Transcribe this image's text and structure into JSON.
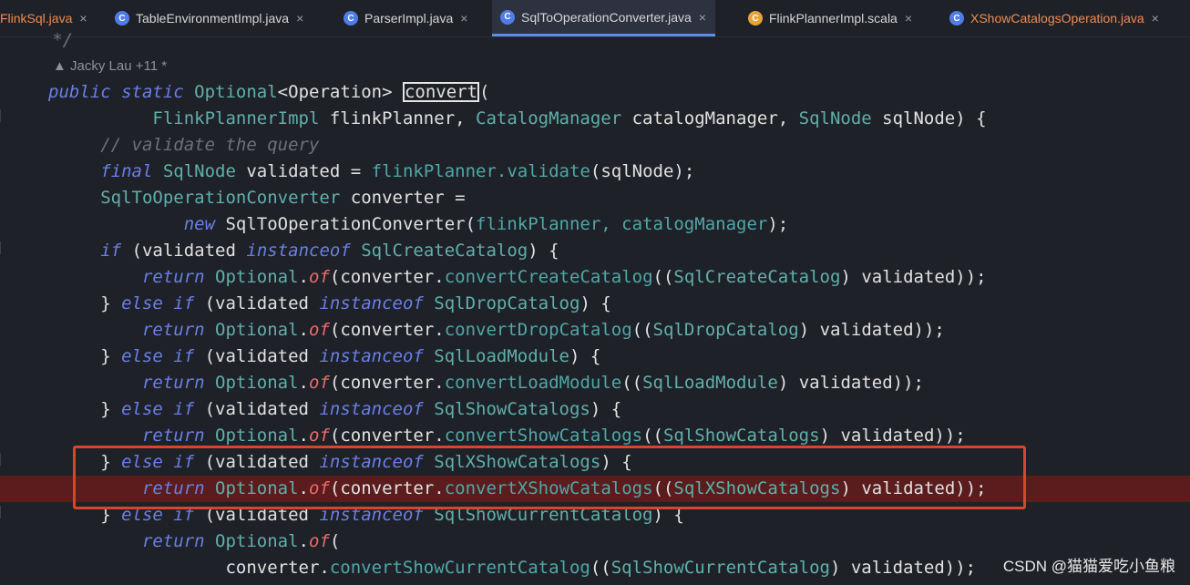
{
  "tabs": [
    {
      "label": "FlinkSql.java",
      "icon": "none",
      "active": false
    },
    {
      "label": "TableEnvironmentImpl.java",
      "icon": "class-icon",
      "active": false
    },
    {
      "label": "ParserImpl.java",
      "icon": "class-icon",
      "active": false
    },
    {
      "label": "SqlToOperationConverter.java",
      "icon": "class-icon",
      "active": true
    },
    {
      "label": "FlinkPlannerImpl.scala",
      "icon": "scala-class-icon",
      "active": false
    },
    {
      "label": "XShowCatalogsOperation.java",
      "icon": "class-icon",
      "active": false
    }
  ],
  "tab_close_glyph": "×",
  "tab_icon_letter": "C",
  "author_annotation": "Jacky Lau +11 *",
  "code": {
    "l0": "     */",
    "l2a": "public static ",
    "l2b": "Optional",
    "l2c": "<",
    "l2d": "Operation",
    "l2e": "> ",
    "l2f": "convert",
    "l2g": "(",
    "l3a": "          ",
    "l3b": "FlinkPlannerImpl",
    "l3c": " flinkPlanner, ",
    "l3d": "CatalogManager",
    "l3e": " catalogManager, ",
    "l3f": "SqlNode",
    "l3g": " sqlNode) {",
    "l4": "     // validate the query",
    "l5a": "     ",
    "l5b": "final ",
    "l5c": "SqlNode",
    "l5d": " validated = ",
    "l5e": "flinkPlanner.",
    "l5f": "validate",
    "l5g": "(sqlNode);",
    "l6a": "     ",
    "l6b": "SqlToOperationConverter",
    "l6c": " converter =",
    "l7a": "             ",
    "l7b": "new ",
    "l7c": "SqlToOperationConverter(",
    "l7d": "flinkPlanner, catalogManager",
    "l7e": ");",
    "l8a": "     ",
    "l8b": "if",
    "l8c": " (validated ",
    "l8d": "instanceof ",
    "l8e": "SqlCreateCatalog",
    "l8f": ") {",
    "l9a": "         ",
    "l9b": "return ",
    "l9c": "Optional",
    "l9d": ".",
    "l9e": "of",
    "l9f": "(converter.",
    "l9g": "convertCreateCatalog",
    "l9h": "((",
    "l9i": "SqlCreateCatalog",
    "l9j": ") validated));",
    "l10a": "     } ",
    "l10b": "else if",
    "l10c": " (validated ",
    "l10d": "instanceof ",
    "l10e": "SqlDropCatalog",
    "l10f": ") {",
    "l11a": "         ",
    "l11b": "return ",
    "l11c": "Optional",
    "l11d": ".",
    "l11e": "of",
    "l11f": "(converter.",
    "l11g": "convertDropCatalog",
    "l11h": "((",
    "l11i": "SqlDropCatalog",
    "l11j": ") validated));",
    "l12a": "     } ",
    "l12b": "else if",
    "l12c": " (validated ",
    "l12d": "instanceof ",
    "l12e": "SqlLoadModule",
    "l12f": ") {",
    "l13a": "         ",
    "l13b": "return ",
    "l13c": "Optional",
    "l13d": ".",
    "l13e": "of",
    "l13f": "(converter.",
    "l13g": "convertLoadModule",
    "l13h": "((",
    "l13i": "SqlLoadModule",
    "l13j": ") validated));",
    "l14a": "     } ",
    "l14b": "else if",
    "l14c": " (validated ",
    "l14d": "instanceof ",
    "l14e": "SqlShowCatalogs",
    "l14f": ") {",
    "l15a": "         ",
    "l15b": "return ",
    "l15c": "Optional",
    "l15d": ".",
    "l15e": "of",
    "l15f": "(converter.",
    "l15g": "convertShowCatalogs",
    "l15h": "((",
    "l15i": "SqlShowCatalogs",
    "l15j": ") validated));",
    "l16a": "     } ",
    "l16b": "else if",
    "l16c": " (validated ",
    "l16d": "instanceof ",
    "l16e": "SqlXShowCatalogs",
    "l16f": ") {",
    "l17a": "         ",
    "l17b": "return ",
    "l17c": "Optional",
    "l17d": ".",
    "l17e": "of",
    "l17f": "(converter.",
    "l17g": "convertXShowCatalogs",
    "l17h": "((",
    "l17i": "SqlXShowCatalogs",
    "l17j": ") validated));",
    "l18a": "     } ",
    "l18b": "else if",
    "l18c": " (validated ",
    "l18d": "instanceof ",
    "l18e": "SqlShowCurrentCatalog",
    "l18f": ") {",
    "l19a": "         ",
    "l19b": "return ",
    "l19c": "Optional",
    "l19d": ".",
    "l19e": "of",
    "l19f": "(",
    "l20a": "                 converter.",
    "l20b": "convertShowCurrentCatalog",
    "l20c": "((",
    "l20d": "SqlShowCurrentCatalog",
    "l20e": ") validated));"
  },
  "watermark": "CSDN @猫猫爱吃小鱼粮",
  "colors": {
    "keyword": "#6a7fe6",
    "type": "#5fb0ab",
    "highlight": "#5b1c1d",
    "redbox": "#d8452c",
    "tab_active_underline": "#5b8def"
  }
}
